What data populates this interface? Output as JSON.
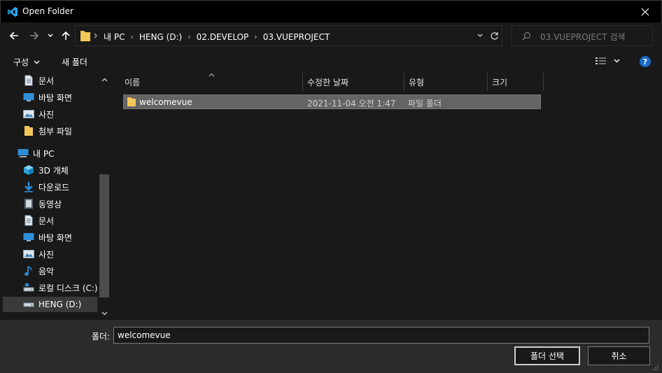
{
  "window": {
    "title": "Open Folder",
    "close_glyph": "✕"
  },
  "address": {
    "crumbs": [
      "내 PC",
      "HENG (D:)",
      "02.DEVELOP",
      "03.VUEPROJECT"
    ]
  },
  "search": {
    "placeholder": "03.VUEPROJECT 검색"
  },
  "toolbar": {
    "organize_label": "구성",
    "new_folder_label": "새 폴더",
    "help_label": "?"
  },
  "nav": {
    "items": [
      {
        "label": "문서",
        "icon": "document-icon"
      },
      {
        "label": "바탕 화면",
        "icon": "desktop-icon"
      },
      {
        "label": "사진",
        "icon": "pictures-icon"
      },
      {
        "label": "첨부 파일",
        "icon": "folder-icon"
      },
      {
        "label": "내 PC",
        "icon": "pc-icon"
      },
      {
        "label": "3D 개체",
        "icon": "3d-objects-icon"
      },
      {
        "label": "다운로드",
        "icon": "download-icon"
      },
      {
        "label": "동영상",
        "icon": "video-icon"
      },
      {
        "label": "문서",
        "icon": "document-icon"
      },
      {
        "label": "바탕 화면",
        "icon": "desktop-icon"
      },
      {
        "label": "사진",
        "icon": "pictures-icon"
      },
      {
        "label": "음악",
        "icon": "music-icon"
      },
      {
        "label": "로컬 디스크 (C:)",
        "icon": "drive-icon"
      },
      {
        "label": "HENG (D:)",
        "icon": "drive-icon"
      }
    ]
  },
  "files": {
    "columns": [
      "이름",
      "수정한 날짜",
      "유형",
      "크기"
    ],
    "rows": [
      {
        "name": "welcomevue",
        "modified": "2021-11-04 오전 1:47",
        "type": "파일 폴더",
        "size": ""
      }
    ]
  },
  "bottom": {
    "folder_label": "폴더:",
    "folder_value": "welcomevue",
    "select_button": "폴더 선택",
    "cancel_button": "취소"
  },
  "colors": {
    "accent": "#1b6ac9",
    "folder": "#f3c85a",
    "vscode_blue": "#23a9f2"
  }
}
